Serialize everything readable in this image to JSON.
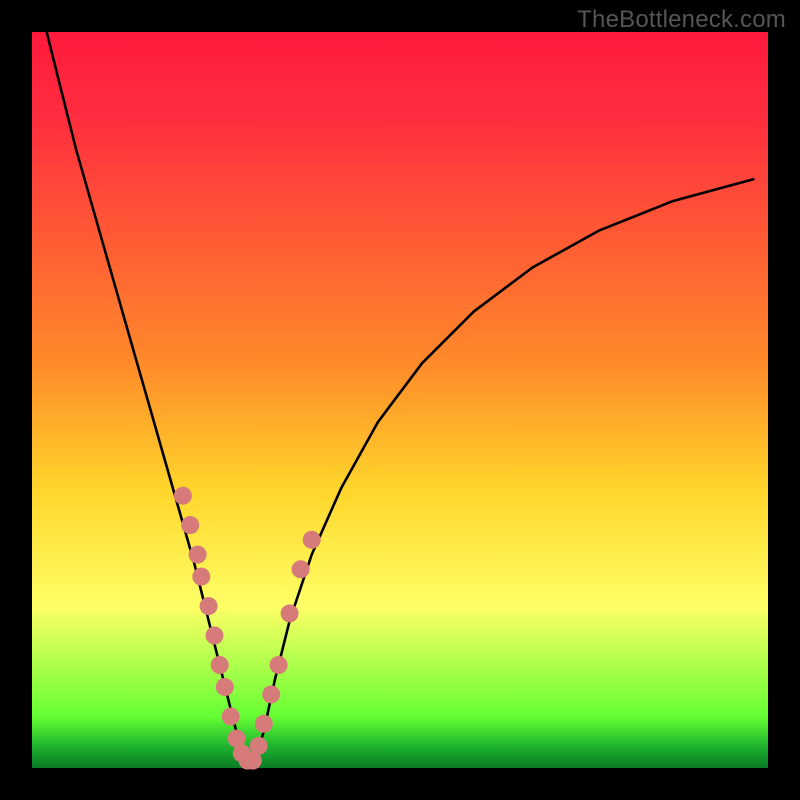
{
  "watermark": "TheBottleneck.com",
  "colors": {
    "top": "#ff1a3b",
    "red": "#ff2e3f",
    "orange": "#ff8a2a",
    "yellow": "#ffd52a",
    "lightyellow": "#ffff66",
    "lime": "#66ff33",
    "green": "#1eb42e",
    "deepgreen": "#0a7a25",
    "curve": "#000000",
    "dot": "#d67a7a"
  },
  "chart_data": {
    "type": "line",
    "title": "",
    "xlabel": "",
    "ylabel": "",
    "xlim": [
      0,
      100
    ],
    "ylim": [
      0,
      100
    ],
    "grid": false,
    "series": [
      {
        "name": "bottleneck-curve",
        "x": [
          2,
          4,
          6,
          8,
          10,
          12,
          14,
          16,
          18,
          20,
          22,
          23.5,
          25,
          26.5,
          27.5,
          28.5,
          29.5,
          30,
          31.5,
          33,
          35,
          38,
          42,
          47,
          53,
          60,
          68,
          77,
          87,
          98
        ],
        "y": [
          100,
          92,
          84,
          77,
          70,
          63,
          56,
          49,
          42,
          35,
          28,
          22,
          16,
          10,
          6,
          2,
          0,
          0,
          5,
          12,
          20,
          29,
          38,
          47,
          55,
          62,
          68,
          73,
          77,
          80
        ]
      }
    ],
    "annotations": {
      "dots": [
        {
          "x": 20.5,
          "y": 37
        },
        {
          "x": 21.5,
          "y": 33
        },
        {
          "x": 22.5,
          "y": 29
        },
        {
          "x": 23.0,
          "y": 26
        },
        {
          "x": 24.0,
          "y": 22
        },
        {
          "x": 24.8,
          "y": 18
        },
        {
          "x": 25.5,
          "y": 14
        },
        {
          "x": 26.2,
          "y": 11
        },
        {
          "x": 27.0,
          "y": 7
        },
        {
          "x": 27.8,
          "y": 4
        },
        {
          "x": 28.5,
          "y": 2
        },
        {
          "x": 29.3,
          "y": 1
        },
        {
          "x": 30.0,
          "y": 1
        },
        {
          "x": 30.8,
          "y": 3
        },
        {
          "x": 31.5,
          "y": 6
        },
        {
          "x": 32.5,
          "y": 10
        },
        {
          "x": 33.5,
          "y": 14
        },
        {
          "x": 35.0,
          "y": 21
        },
        {
          "x": 36.5,
          "y": 27
        },
        {
          "x": 38.0,
          "y": 31
        }
      ]
    }
  }
}
